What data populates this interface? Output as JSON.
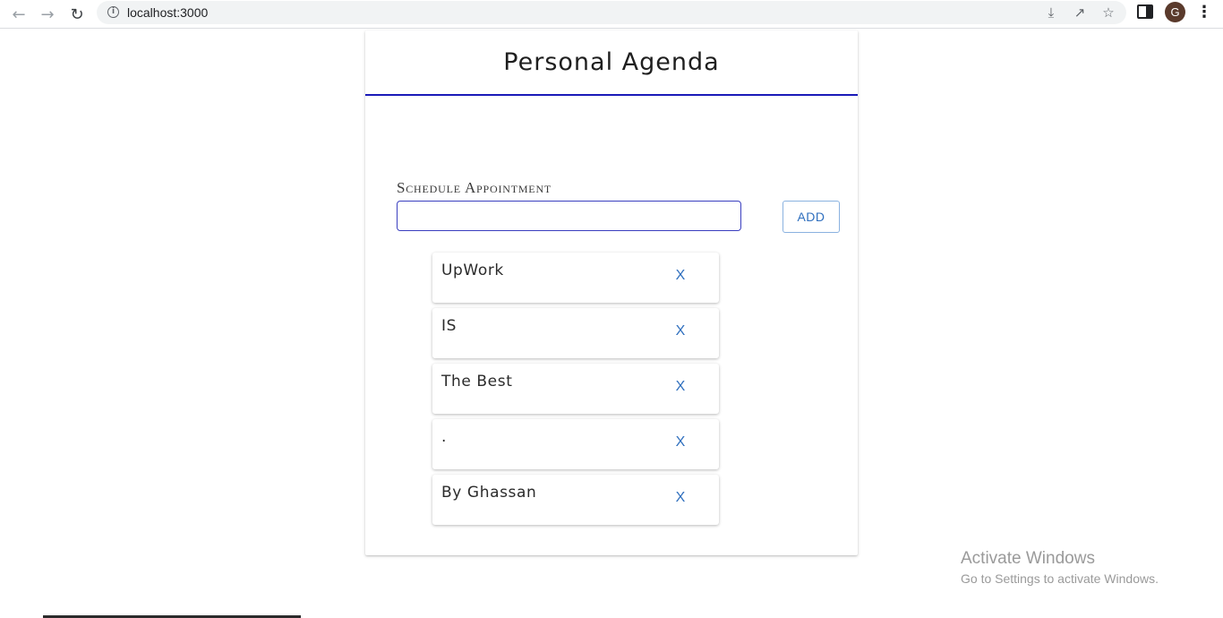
{
  "browser": {
    "url": "localhost:3000",
    "avatar_letter": "G",
    "icons": {
      "back": "back-arrow-icon",
      "forward": "forward-arrow-icon",
      "reload": "reload-icon",
      "info": "info-icon",
      "install": "install-app-icon",
      "share": "share-icon",
      "bookmark": "star-icon",
      "side_panel": "side-panel-icon",
      "menu": "kebab-menu-icon"
    }
  },
  "app": {
    "title": "Personal Agenda",
    "accent_color": "#1a1ab8",
    "form": {
      "label": "Schedule Appointment",
      "input_value": "",
      "add_label": "ADD"
    },
    "appointments": [
      {
        "text": "UpWork",
        "delete_label": "X"
      },
      {
        "text": "IS",
        "delete_label": "X"
      },
      {
        "text": "The Best",
        "delete_label": "X"
      },
      {
        "text": ".",
        "delete_label": "X"
      },
      {
        "text": "By Ghassan",
        "delete_label": "X"
      }
    ]
  },
  "watermark": {
    "title": "Activate Windows",
    "subtitle": "Go to Settings to activate Windows."
  }
}
